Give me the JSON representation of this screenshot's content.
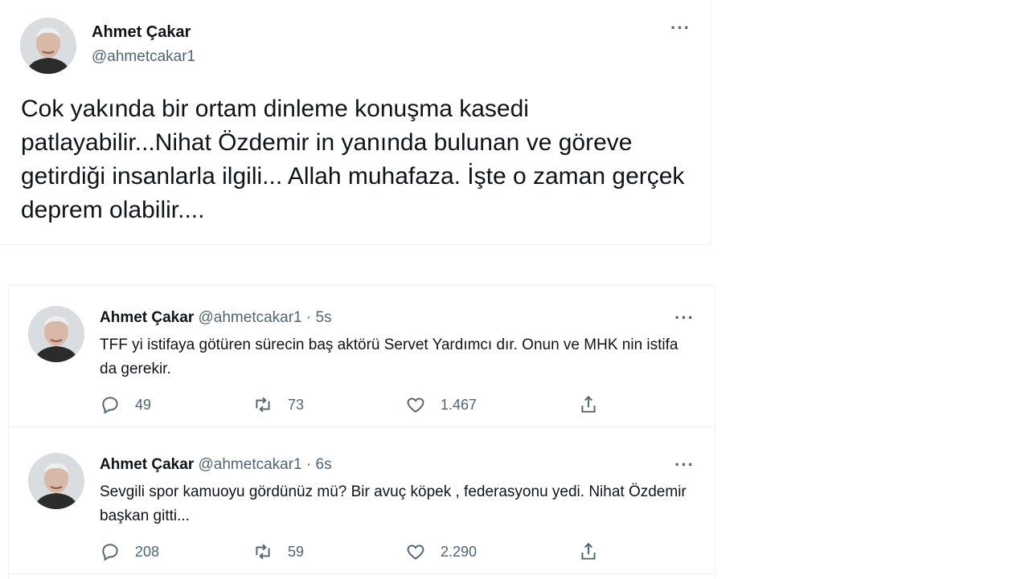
{
  "main_tweet": {
    "name": "Ahmet Çakar",
    "handle": "@ahmetcakar1",
    "text": "Cok yakında bir ortam dinleme konuşma kasedi patlayabilir...Nihat  Özdemir in yanında bulunan ve göreve getirdiği insanlarla ilgili... Allah muhafaza. İşte o zaman gerçek deprem olabilir...."
  },
  "feed": [
    {
      "name": "Ahmet Çakar",
      "handle_time": "@ahmetcakar1 · 5s",
      "text": "TFF yi istifaya götüren sürecin baş aktörü Servet Yardımcı dır. Onun ve MHK nin istifa da gerekir.",
      "replies": "49",
      "retweets": "73",
      "likes": "1.467"
    },
    {
      "name": "Ahmet Çakar",
      "handle_time": "@ahmetcakar1 · 6s",
      "text": "Sevgili spor kamuoyu gördünüz mü?  Bir avuç köpek , federasyonu yedi. Nihat Özdemir başkan gitti...",
      "replies": "208",
      "retweets": "59",
      "likes": "2.290"
    }
  ],
  "icons": {
    "more": "more-horizontal-icon",
    "reply": "reply-icon",
    "retweet": "retweet-icon",
    "like": "heart-icon",
    "share": "share-icon"
  },
  "colors": {
    "text": "#0f1419",
    "secondary": "#536471",
    "border": "#eff3f4"
  }
}
